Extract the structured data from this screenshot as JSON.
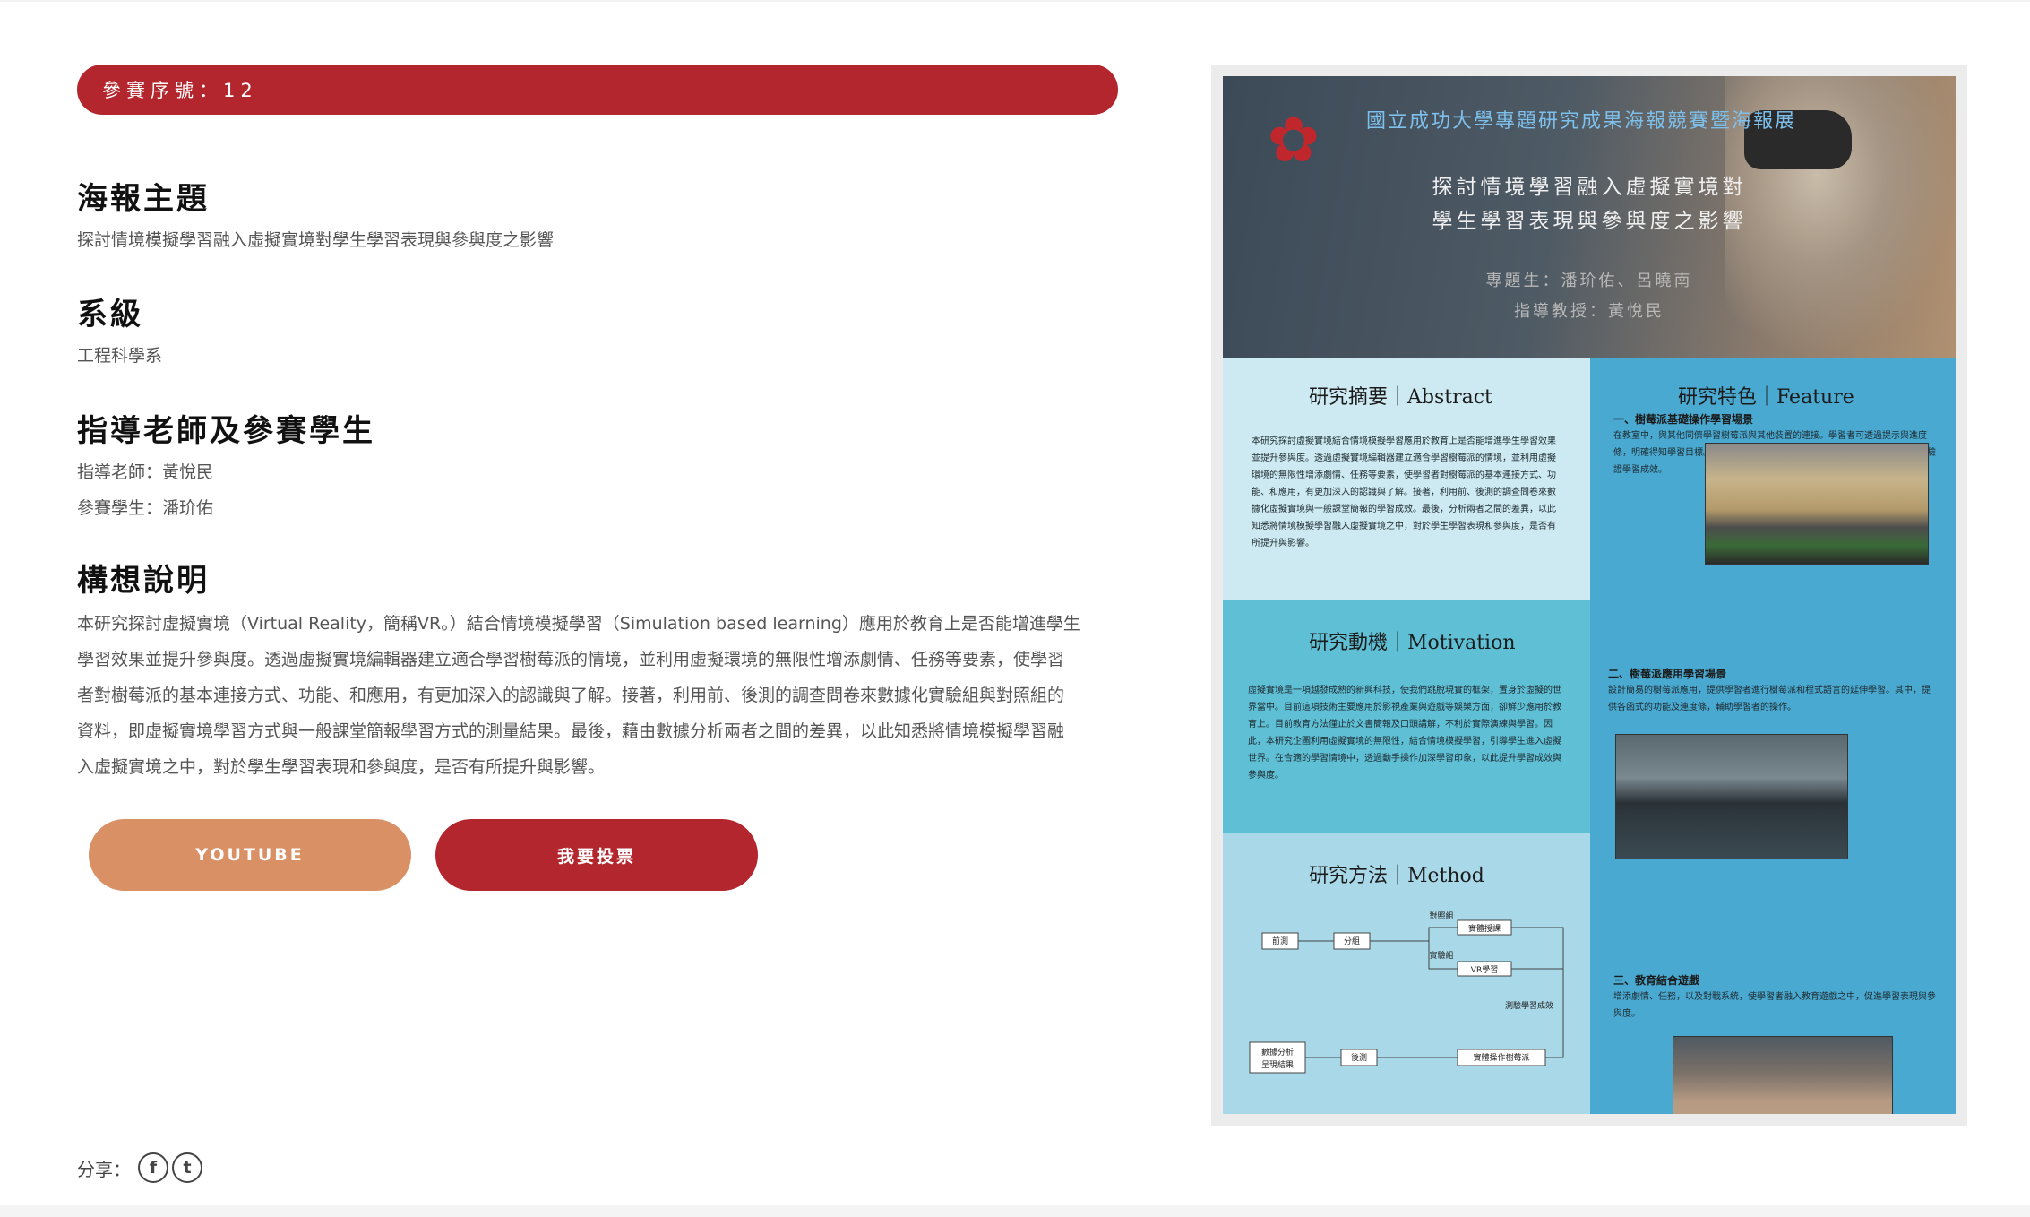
{
  "entry": {
    "badge": "參賽序號：12"
  },
  "sections": {
    "topic": {
      "title": "海報主題",
      "value": "探討情境模擬學習融入虛擬實境對學生學習表現與參與度之影響"
    },
    "department": {
      "title": "系級",
      "value": "工程科學系"
    },
    "people": {
      "title": "指導老師及參賽學生",
      "advisor": "指導老師：黃悅民",
      "student": "參賽學生：潘玠佑"
    },
    "concept": {
      "title": "構想說明",
      "lines": [
        "本研究探討虛擬實境（Virtual Reality，簡稱VR。）結合情境模擬學習（Simulation based learning）應用於教育上是否能增進學生",
        "學習效果並提升參與度。透過虛擬實境編輯器建立適合學習樹莓派的情境，並利用虛擬環境的無限性增添劇情、任務等要素，使學習",
        "者對樹莓派的基本連接方式、功能、和應用，有更加深入的認識與了解。接著，利用前、後測的調查問卷來數據化實驗組與對照組的",
        "資料，即虛擬實境學習方式與一般課堂簡報學習方式的測量結果。最後，藉由數據分析兩者之間的差異，以此知悉將情境模擬學習融",
        "入虛擬實境之中，對於學生學習表現和參與度，是否有所提升與影響。"
      ]
    }
  },
  "buttons": {
    "youtube": "YOUTUBE",
    "vote": "我要投票"
  },
  "share": {
    "label": "分享：",
    "facebook_glyph": "f",
    "twitter_glyph": "t"
  },
  "poster": {
    "university": "國立成功大學專題研究成果海報競賽暨海報展",
    "title_line1": "探討情境學習融入虛擬實境對",
    "title_line2": "學生學習表現與參與度之影響",
    "students": "專題生：潘玠佑、呂曉南",
    "advisor": "指導教授：黃悅民",
    "abstract_heading": "研究摘要｜Abstract",
    "abstract_text": "本研究探討虛擬實境結合情境模擬學習應用於教育上是否能增進學生學習效果並提升參與度。透過虛擬實境編輯器建立適合學習樹莓派的情境，並利用虛擬環境的無限性增添劇情、任務等要素，使學習者對樹莓派的基本連接方式、功能、和應用，有更加深入的認識與了解。接著，利用前、後測的調查問卷來數據化虛擬實境與一般課堂簡報的學習成效。最後，分析兩者之間的差異，以此知悉將情境模擬學習融入虛擬實境之中，對於學生學習表現和參與度，是否有所提升與影響。",
    "motivation_heading": "研究動機｜Motivation",
    "motivation_text": "虛擬實境是一項越發成熟的新興科技，使我們跳脫現實的框架，置身於虛擬的世界當中。目前這項技術主要應用於影視產業與遊戲等娛樂方面，卻鮮少應用於教育上。目前教育方法僅止於文書簡報及口頭講解，不利於實際演練與學習。因此，本研究企圖利用虛擬實境的無限性，結合情境模擬學習，引導學生進入虛擬世界。在合適的學習情境中，透過動手操作加深學習印象，以此提升學習成效與參與度。",
    "method_heading": "研究方法｜Method",
    "flow": {
      "pretest": "前測",
      "group": "分組",
      "control": "對照組",
      "experiment": "實驗組",
      "lecture": "實體授課",
      "vr": "VR學習",
      "measure": "測驗學習成效",
      "analysis_line1": "數據分析",
      "analysis_line2": "呈現結果",
      "posttest": "後測",
      "hands_on": "實體操作樹莓派"
    },
    "feature_heading": "研究特色｜Feature",
    "feature1_title": "一、樹莓派基礎操作學習場景",
    "feature1_text": "在教室中，與其他同儕學習樹莓派與其他裝置的連接。學習者可透過提示與進度條，明確得知學習目標。此外，當學習者達成特定進度時，將觸發任務使學習者驗證學習成效。",
    "feature2_title": "二、樹莓派應用學習場景",
    "feature2_text": "設計簡易的樹莓派應用，提供學習者進行樹莓派和程式語言的延伸學習。其中，提供各函式的功能及連度條，輔助學習者的操作。",
    "feature3_title": "三、教育結合遊戲",
    "feature3_text": "增添劇情、任務，以及對戰系統，使學習者融入教育遊戲之中，促進學習表現與參與度。"
  },
  "colors": {
    "accent_red": "#b3262d",
    "youtube_orange": "#d99064",
    "poster_light_blue": "#cdeaf2",
    "poster_mid_blue": "#5fbfd5",
    "poster_right_blue": "#4aa9d0"
  }
}
